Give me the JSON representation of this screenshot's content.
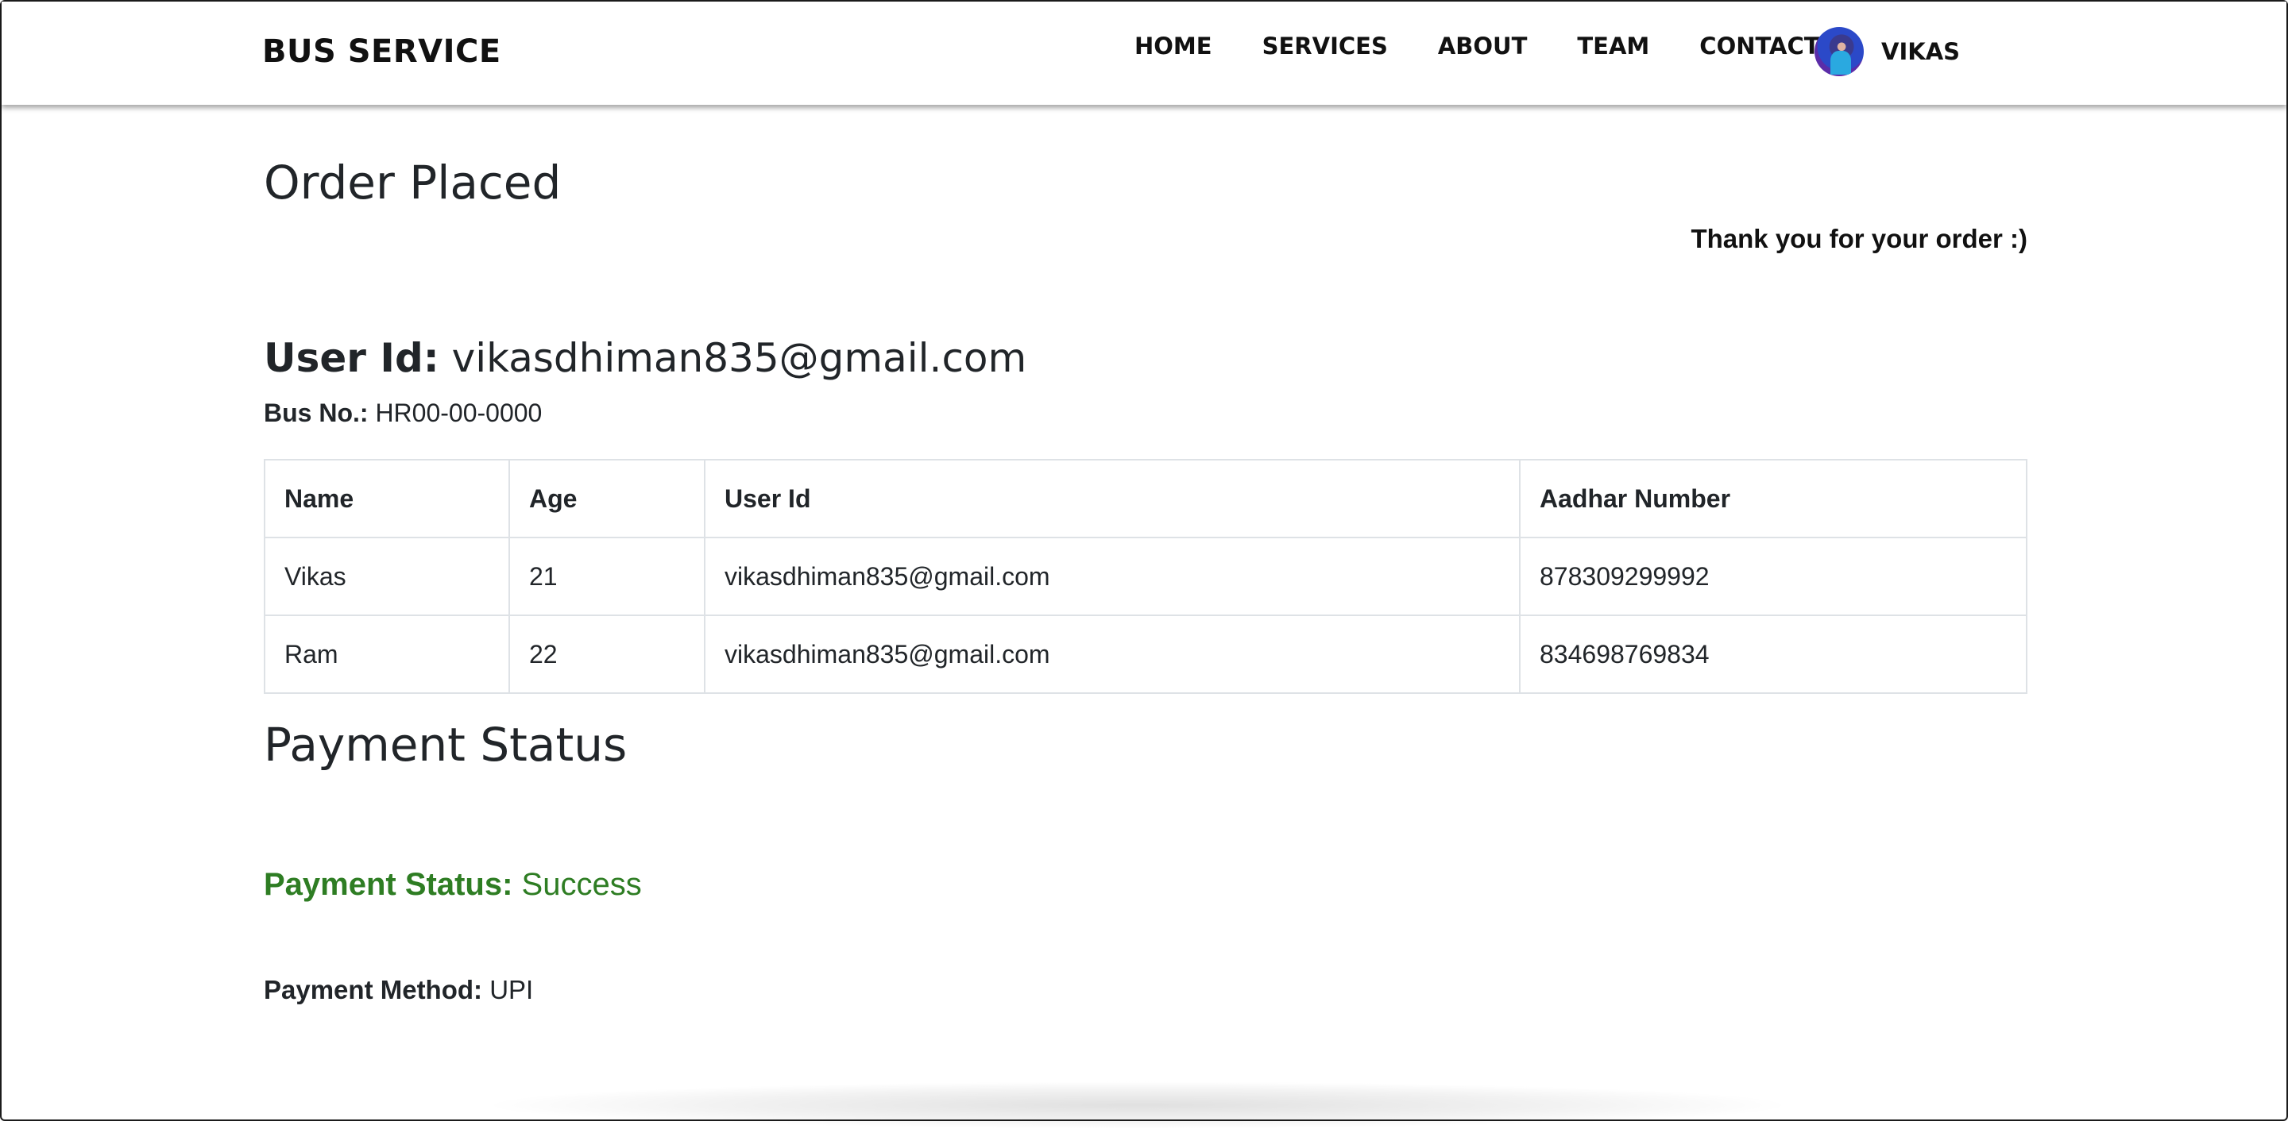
{
  "navbar": {
    "brand": "BUS SERVICE",
    "links": [
      "HOME",
      "SERVICES",
      "ABOUT",
      "TEAM",
      "CONTACT"
    ],
    "profile_name": "VIKAS"
  },
  "order": {
    "title": "Order Placed",
    "thanks": "Thank you for your order :)",
    "user_id_label": "User Id:",
    "user_id_value": "vikasdhiman835@gmail.com",
    "bus_no_label": "Bus No.:",
    "bus_no_value": "HR00-00-0000"
  },
  "table": {
    "headers": [
      "Name",
      "Age",
      "User Id",
      "Aadhar Number"
    ],
    "rows": [
      [
        "Vikas",
        "21",
        "vikasdhiman835@gmail.com",
        "878309299992"
      ],
      [
        "Ram",
        "22",
        "vikasdhiman835@gmail.com",
        "834698769834"
      ]
    ]
  },
  "payment": {
    "title": "Payment Status",
    "status_label": "Payment Status:",
    "status_value": "Success",
    "method_label": "Payment Method:",
    "method_value": "UPI"
  },
  "colors": {
    "success": "#2e7d23",
    "text": "#212529",
    "border": "#dee2e6"
  }
}
